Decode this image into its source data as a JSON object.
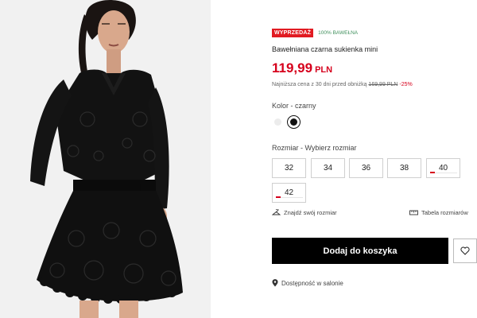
{
  "product": {
    "badge_sale": "WYPRZEDAŻ",
    "badge_material": "100% BAWEŁNA",
    "title": "Bawełniana czarna sukienka mini",
    "price_amount": "119,99",
    "price_currency": "PLN",
    "lowest_prefix": "Najniższa cena z 30 dni przed obniżką",
    "lowest_old_price": "169,99 PLN",
    "lowest_discount": "-25%"
  },
  "color": {
    "label": "Kolor - czarny",
    "swatches": [
      "light-grey",
      "black"
    ],
    "selected": "black"
  },
  "size": {
    "label_prefix": "Rozmiar - ",
    "label_value": "Wybierz rozmiar",
    "options": [
      "32",
      "34",
      "36",
      "38",
      "40",
      "42"
    ],
    "low_stock": [
      "40",
      "42"
    ]
  },
  "links": {
    "find_size": "Znajdź swój rozmiar",
    "size_table": "Tabela rozmiarów",
    "store_availability": "Dostępność w salonie"
  },
  "actions": {
    "add_to_cart": "Dodaj do koszyka"
  },
  "colors": {
    "accent_red": "#d6001c",
    "sale_badge": "#e11b22",
    "material_green": "#3f8f5c",
    "button_black": "#000000"
  },
  "icons": {
    "find_size": "hanger-icon",
    "size_table": "ruler-icon",
    "wishlist": "heart-icon",
    "store": "location-pin-icon"
  }
}
